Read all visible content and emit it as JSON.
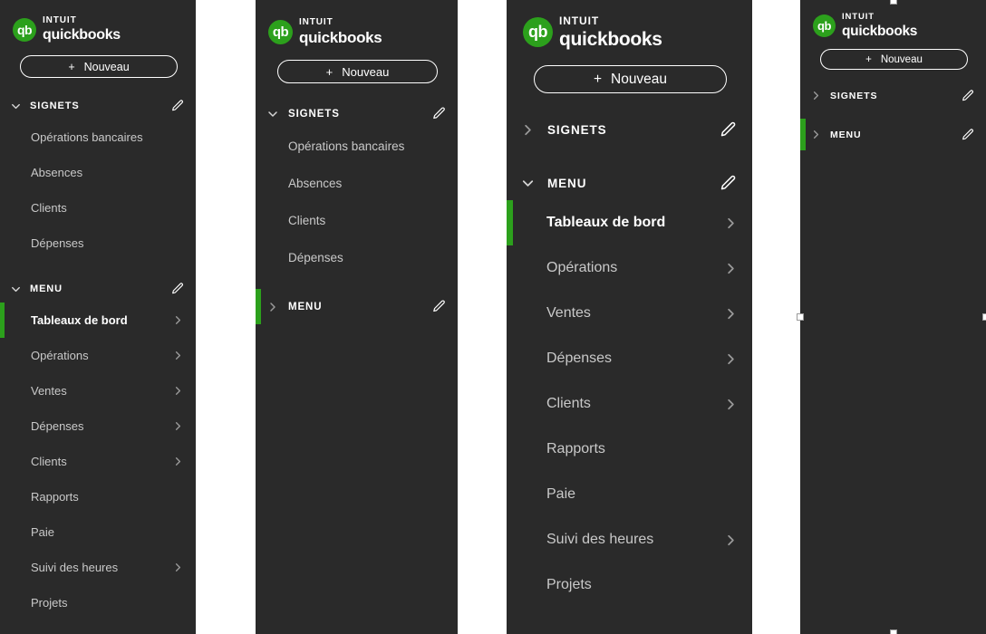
{
  "brand": {
    "mark_text": "qb",
    "line1": "INTUIT",
    "line2": "quickbooks",
    "mark_color": "#2ca01c"
  },
  "colors": {
    "panel_background": "#2a2a2a",
    "page_background": "#ffffff",
    "accent_green": "#2ca01c",
    "label_text": "#c9c9c9",
    "active_text": "#ffffff"
  },
  "new_button": {
    "plus": "+",
    "label": "Nouveau"
  },
  "sections": {
    "bookmarks_label": "SIGNETS",
    "menu_label": "MENU",
    "edit_icon": "pencil-icon",
    "expanded_icon": "chevron-down-icon",
    "collapsed_icon": "chevron-right-icon"
  },
  "bookmark_items": [
    {
      "label": "Opérations bancaires"
    },
    {
      "label": "Absences"
    },
    {
      "label": "Clients"
    },
    {
      "label": "Dépenses"
    }
  ],
  "menu_items": [
    {
      "label": "Tableaux de bord",
      "has_arrow": true,
      "active": true
    },
    {
      "label": "Opérations",
      "has_arrow": true,
      "active": false
    },
    {
      "label": "Ventes",
      "has_arrow": true,
      "active": false
    },
    {
      "label": "Dépenses",
      "has_arrow": true,
      "active": false
    },
    {
      "label": "Clients",
      "has_arrow": true,
      "active": false
    },
    {
      "label": "Rapports",
      "has_arrow": false,
      "active": false
    },
    {
      "label": "Paie",
      "has_arrow": false,
      "active": false
    },
    {
      "label": "Suivi des heures",
      "has_arrow": true,
      "active": false
    },
    {
      "label": "Projets",
      "has_arrow": false,
      "active": false
    }
  ],
  "panels": [
    {
      "name": "panel-1-both-expanded",
      "bookmarks_expanded": true,
      "menu_expanded": true,
      "accent_on": "menu-item-0"
    },
    {
      "name": "panel-2-menu-collapsed",
      "bookmarks_expanded": true,
      "menu_expanded": false,
      "accent_on": "menu-header"
    },
    {
      "name": "panel-3-bookmarks-collapsed",
      "bookmarks_expanded": false,
      "menu_expanded": true,
      "accent_on": "menu-item-0"
    },
    {
      "name": "panel-4-both-collapsed",
      "bookmarks_expanded": false,
      "menu_expanded": false,
      "accent_on": "menu-header"
    }
  ],
  "selection_handles": {
    "count": 4,
    "positions": [
      "top-center",
      "left-middle",
      "right-middle",
      "bottom-center"
    ]
  }
}
